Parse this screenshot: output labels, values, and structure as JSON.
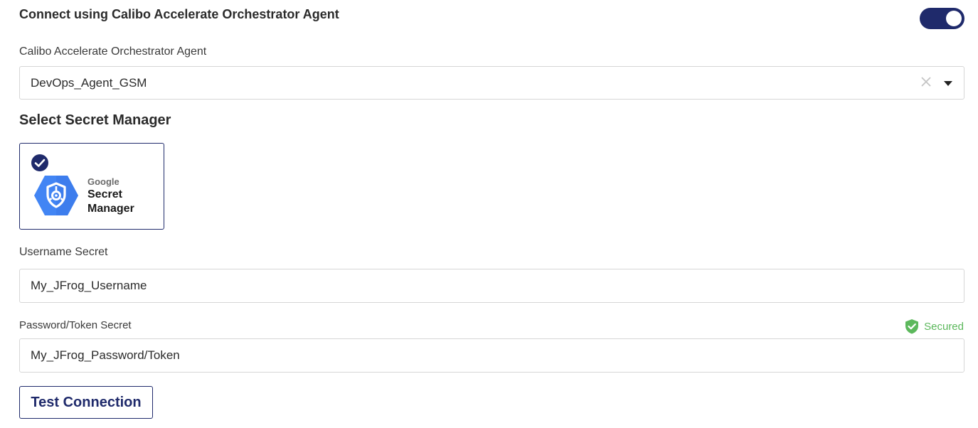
{
  "connect": {
    "title": "Connect using Calibo Accelerate Orchestrator Agent",
    "toggle_on": true
  },
  "agent": {
    "label": "Calibo Accelerate Orchestrator Agent",
    "value": "DevOps_Agent_GSM",
    "clear_icon": "close-icon",
    "dropdown_icon": "caret-down-icon"
  },
  "secret_manager": {
    "title": "Select Secret Manager",
    "options": [
      {
        "vendor": "Google",
        "name": "Secret Manager",
        "selected": true,
        "icon": "google-secret-manager-icon"
      }
    ]
  },
  "username": {
    "label": "Username Secret",
    "value": "My_JFrog_Username"
  },
  "password": {
    "label": "Password/Token Secret",
    "value": "My_JFrog_Password/Token",
    "status": "Secured",
    "status_icon": "shield-check-icon"
  },
  "actions": {
    "test_label": "Test Connection"
  },
  "colors": {
    "accent": "#1f2a6b",
    "secured": "#5cb85c",
    "google_blue": "#4285f4",
    "border": "#d6d6d6"
  }
}
